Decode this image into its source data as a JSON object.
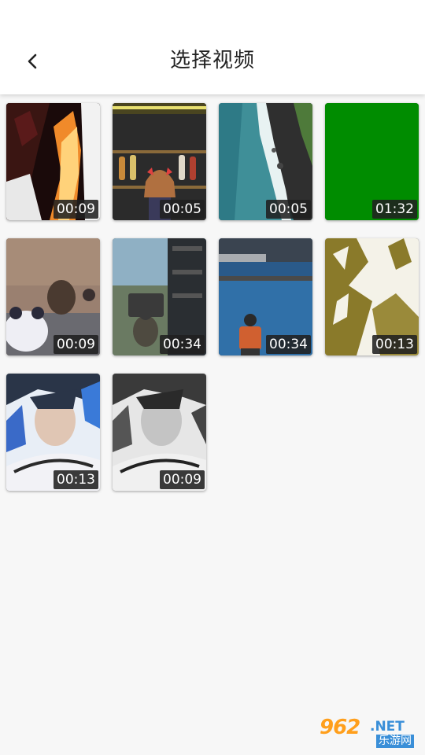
{
  "header": {
    "title": "选择视频",
    "back_icon": "chevron-left-icon"
  },
  "videos": [
    {
      "duration": "00:09",
      "thumb": "fire"
    },
    {
      "duration": "00:05",
      "thumb": "anime-guitars"
    },
    {
      "duration": "00:05",
      "thumb": "aerial-coast"
    },
    {
      "duration": "01:32",
      "thumb": "green-screen"
    },
    {
      "duration": "00:09",
      "thumb": "game-soldiers"
    },
    {
      "duration": "00:34",
      "thumb": "game-truck"
    },
    {
      "duration": "00:34",
      "thumb": "game-lake"
    },
    {
      "duration": "00:13",
      "thumb": "gold-texture"
    },
    {
      "duration": "00:13",
      "thumb": "painted-portrait-color"
    },
    {
      "duration": "00:09",
      "thumb": "painted-portrait-bw"
    }
  ],
  "watermark": {
    "number": "962",
    "domain": ".NET",
    "cn": "乐游网"
  },
  "colors": {
    "header_bg": "#ffffff",
    "page_bg": "#f7f7f7",
    "duration_bg": "#202020",
    "green_screen": "#008c00"
  }
}
